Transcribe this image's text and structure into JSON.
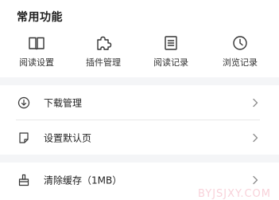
{
  "section": {
    "title": "常用功能"
  },
  "quick": [
    {
      "label": "阅读设置",
      "icon": "book-icon"
    },
    {
      "label": "插件管理",
      "icon": "puzzle-icon"
    },
    {
      "label": "阅读记录",
      "icon": "document-icon"
    },
    {
      "label": "浏览记录",
      "icon": "clock-icon"
    }
  ],
  "list": [
    {
      "label": "下载管理",
      "icon": "download-icon"
    },
    {
      "label": "设置默认页",
      "icon": "page-icon"
    },
    {
      "label": "清除缓存（1MB）",
      "icon": "broom-icon"
    }
  ],
  "watermark": "BYJSJXY.COM",
  "colors": {
    "icon": "#333333",
    "chevron": "#8a8a8a",
    "band": "#f4f5f7",
    "divider": "#e9e9e9"
  }
}
